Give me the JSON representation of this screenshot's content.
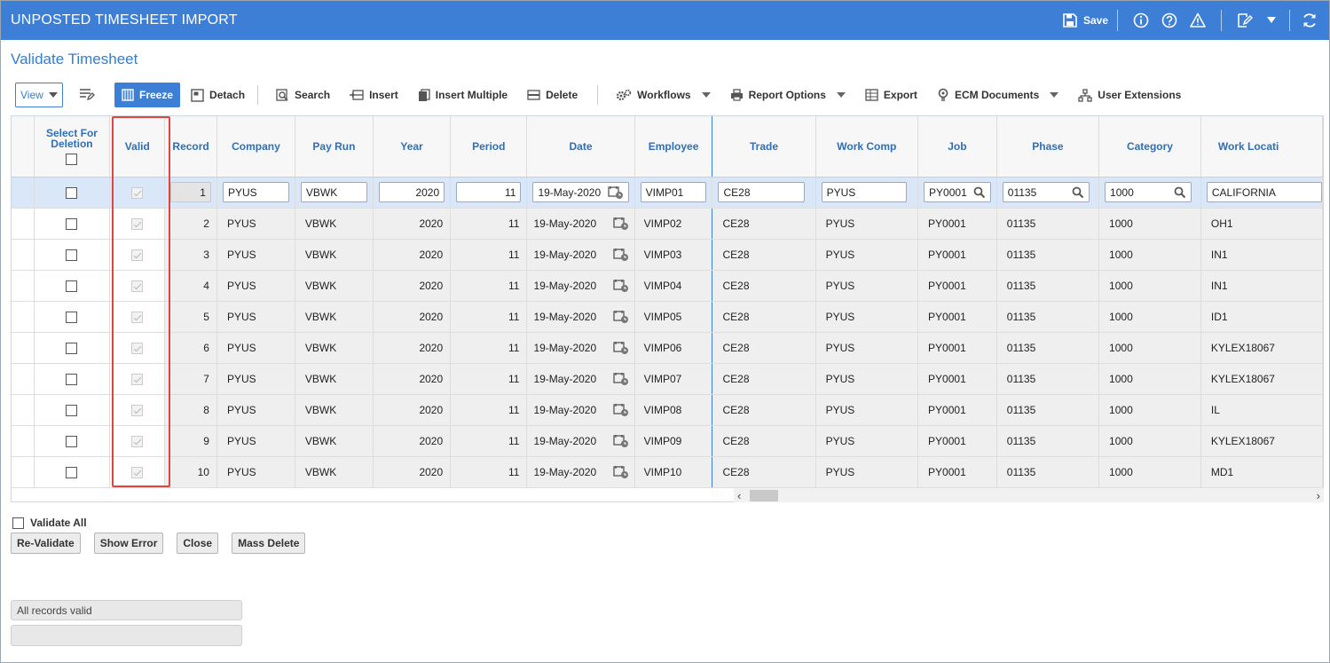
{
  "window": {
    "title": "UNPOSTED TIMESHEET IMPORT"
  },
  "header_tools": {
    "save_label": "Save"
  },
  "page": {
    "subtitle": "Validate Timesheet"
  },
  "toolbar": {
    "view_label": "View",
    "freeze": "Freeze",
    "detach": "Detach",
    "search": "Search",
    "insert": "Insert",
    "insert_multiple": "Insert Multiple",
    "delete": "Delete",
    "workflows": "Workflows",
    "report_options": "Report Options",
    "export": "Export",
    "ecm_documents": "ECM Documents",
    "user_extensions": "User Extensions"
  },
  "grid": {
    "columns": {
      "select_for_deletion": "Select For Deletion",
      "valid": "Valid",
      "record": "Record",
      "company": "Company",
      "pay_run": "Pay Run",
      "year": "Year",
      "period": "Period",
      "date": "Date",
      "employee": "Employee",
      "trade": "Trade",
      "work_comp": "Work Comp",
      "job": "Job",
      "phase": "Phase",
      "category": "Category",
      "work_location": "Work Locati"
    },
    "rows": [
      {
        "record": "1",
        "company": "PYUS",
        "pay_run": "VBWK",
        "year": "2020",
        "period": "11",
        "date": "19-May-2020",
        "employee": "VIMP01",
        "trade": "CE28",
        "work_comp": "PYUS",
        "job": "PY0001",
        "phase": "01135",
        "category": "1000",
        "work_location": "CALIFORNIA"
      },
      {
        "record": "2",
        "company": "PYUS",
        "pay_run": "VBWK",
        "year": "2020",
        "period": "11",
        "date": "19-May-2020",
        "employee": "VIMP02",
        "trade": "CE28",
        "work_comp": "PYUS",
        "job": "PY0001",
        "phase": "01135",
        "category": "1000",
        "work_location": "OH1"
      },
      {
        "record": "3",
        "company": "PYUS",
        "pay_run": "VBWK",
        "year": "2020",
        "period": "11",
        "date": "19-May-2020",
        "employee": "VIMP03",
        "trade": "CE28",
        "work_comp": "PYUS",
        "job": "PY0001",
        "phase": "01135",
        "category": "1000",
        "work_location": "IN1"
      },
      {
        "record": "4",
        "company": "PYUS",
        "pay_run": "VBWK",
        "year": "2020",
        "period": "11",
        "date": "19-May-2020",
        "employee": "VIMP04",
        "trade": "CE28",
        "work_comp": "PYUS",
        "job": "PY0001",
        "phase": "01135",
        "category": "1000",
        "work_location": "IN1"
      },
      {
        "record": "5",
        "company": "PYUS",
        "pay_run": "VBWK",
        "year": "2020",
        "period": "11",
        "date": "19-May-2020",
        "employee": "VIMP05",
        "trade": "CE28",
        "work_comp": "PYUS",
        "job": "PY0001",
        "phase": "01135",
        "category": "1000",
        "work_location": "ID1"
      },
      {
        "record": "6",
        "company": "PYUS",
        "pay_run": "VBWK",
        "year": "2020",
        "period": "11",
        "date": "19-May-2020",
        "employee": "VIMP06",
        "trade": "CE28",
        "work_comp": "PYUS",
        "job": "PY0001",
        "phase": "01135",
        "category": "1000",
        "work_location": "KYLEX18067"
      },
      {
        "record": "7",
        "company": "PYUS",
        "pay_run": "VBWK",
        "year": "2020",
        "period": "11",
        "date": "19-May-2020",
        "employee": "VIMP07",
        "trade": "CE28",
        "work_comp": "PYUS",
        "job": "PY0001",
        "phase": "01135",
        "category": "1000",
        "work_location": "KYLEX18067"
      },
      {
        "record": "8",
        "company": "PYUS",
        "pay_run": "VBWK",
        "year": "2020",
        "period": "11",
        "date": "19-May-2020",
        "employee": "VIMP08",
        "trade": "CE28",
        "work_comp": "PYUS",
        "job": "PY0001",
        "phase": "01135",
        "category": "1000",
        "work_location": "IL"
      },
      {
        "record": "9",
        "company": "PYUS",
        "pay_run": "VBWK",
        "year": "2020",
        "period": "11",
        "date": "19-May-2020",
        "employee": "VIMP09",
        "trade": "CE28",
        "work_comp": "PYUS",
        "job": "PY0001",
        "phase": "01135",
        "category": "1000",
        "work_location": "KYLEX18067"
      },
      {
        "record": "10",
        "company": "PYUS",
        "pay_run": "VBWK",
        "year": "2020",
        "period": "11",
        "date": "19-May-2020",
        "employee": "VIMP10",
        "trade": "CE28",
        "work_comp": "PYUS",
        "job": "PY0001",
        "phase": "01135",
        "category": "1000",
        "work_location": "MD1"
      }
    ]
  },
  "bottom": {
    "validate_all": "Validate All",
    "revalidate": "Re-Validate",
    "show_error": "Show Error",
    "close": "Close",
    "mass_delete": "Mass Delete",
    "status_message": "All records valid",
    "status_message_2": ""
  },
  "colors": {
    "brand": "#3d7ed6",
    "highlight": "#e0463f",
    "header_text": "#2f6fb7"
  }
}
